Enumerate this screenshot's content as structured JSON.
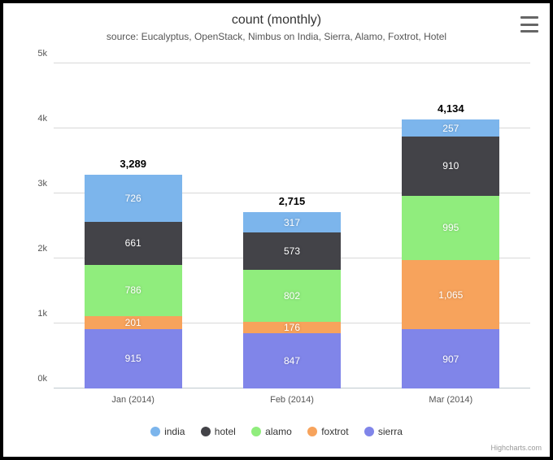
{
  "title": "count (monthly)",
  "subtitle": "source: Eucalyptus, OpenStack, Nimbus on India, Sierra, Alamo, Foxtrot, Hotel",
  "credit": "Highcharts.com",
  "yticks": [
    "0k",
    "1k",
    "2k",
    "3k",
    "4k",
    "5k"
  ],
  "legend": {
    "india": "india",
    "hotel": "hotel",
    "alamo": "alamo",
    "foxtrot": "foxtrot",
    "sierra": "sierra"
  },
  "chart_data": {
    "type": "bar",
    "stacked": true,
    "title": "count (monthly)",
    "xlabel": "",
    "ylabel": "",
    "ylim": [
      0,
      5000
    ],
    "categories": [
      "Jan (2014)",
      "Feb (2014)",
      "Mar (2014)"
    ],
    "series": [
      {
        "name": "sierra",
        "color": "#8085e9",
        "values": [
          915,
          847,
          907
        ]
      },
      {
        "name": "foxtrot",
        "color": "#f7a35c",
        "values": [
          201,
          176,
          1065
        ]
      },
      {
        "name": "alamo",
        "color": "#90ed7d",
        "values": [
          786,
          802,
          995
        ]
      },
      {
        "name": "hotel",
        "color": "#434348",
        "values": [
          661,
          573,
          910
        ]
      },
      {
        "name": "india",
        "color": "#7cb5ec",
        "values": [
          726,
          317,
          257
        ]
      }
    ],
    "totals": [
      "3,289",
      "2,715",
      "4,134"
    ]
  }
}
